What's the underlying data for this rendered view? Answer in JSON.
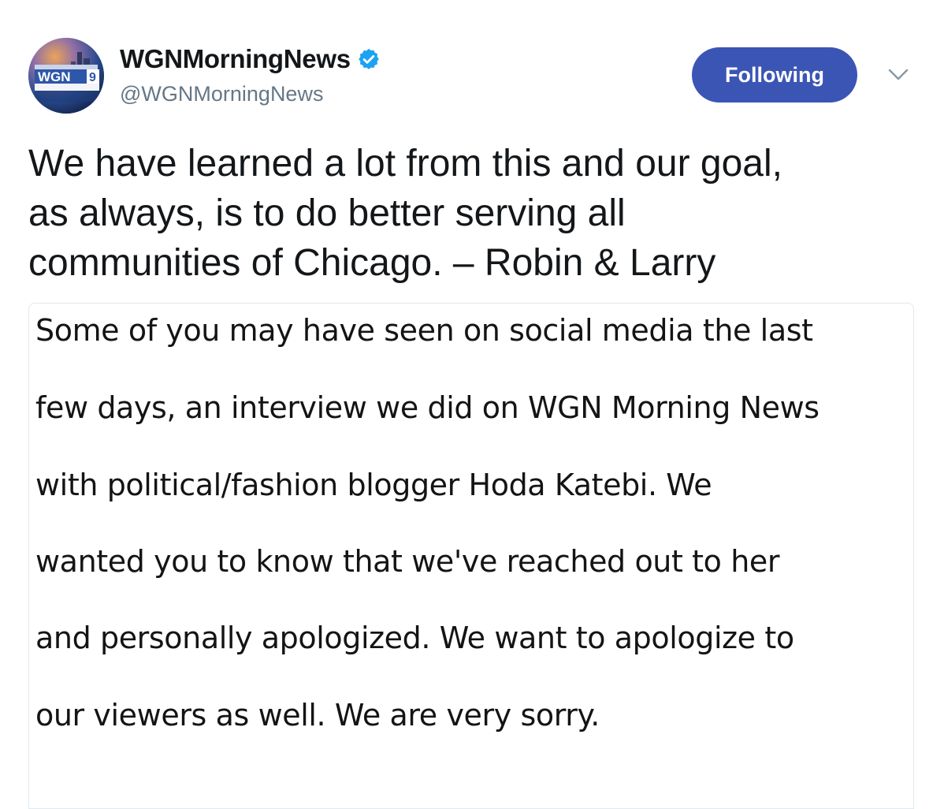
{
  "tweet": {
    "author": {
      "display_name": "WGNMorningNews",
      "handle": "@WGNMorningNews",
      "verified": true,
      "avatar_icon": "wgn9-morning-news-logo"
    },
    "follow_button_label": "Following",
    "menu_icon": "chevron-down-icon",
    "text_lines": [
      "We have learned a lot from this and our goal,",
      "as always, is to do better serving all",
      "communities of Chicago. – Robin & Larry"
    ],
    "media": {
      "lines": [
        "Some of you may have seen on social media the last",
        "few days, an interview we did on WGN Morning News",
        "with political/fashion blogger Hoda Katebi. We",
        "wanted you to know that we've reached out to her",
        "and personally apologized. We want to apologize to",
        "our viewers as well. We are very sorry."
      ]
    }
  },
  "colors": {
    "follow_button_bg": "#3b55b5",
    "verified_badge": "#1da1f2",
    "handle_text": "#657786",
    "body_text": "#14171a"
  }
}
